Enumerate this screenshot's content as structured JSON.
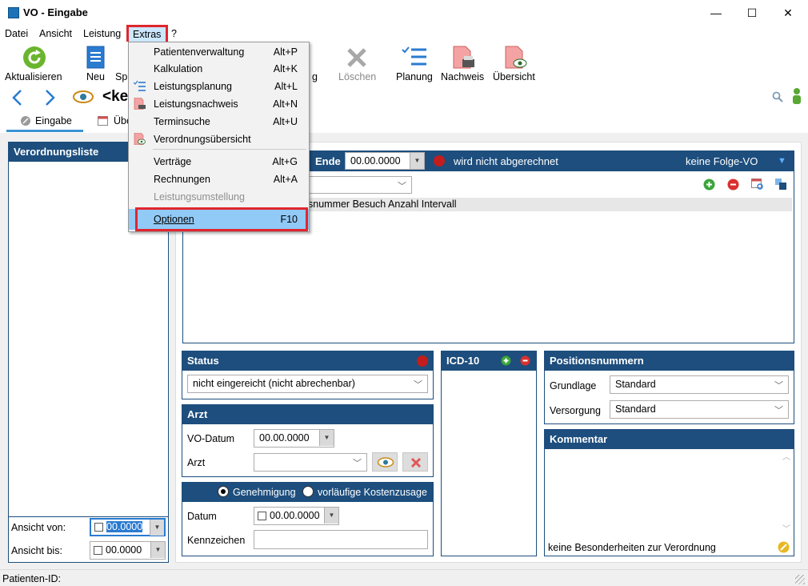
{
  "window": {
    "title": "VO - Eingabe",
    "minimize": "—",
    "maximize": "☐",
    "close": "✕"
  },
  "menu": {
    "datei": "Datei",
    "ansicht": "Ansicht",
    "leistung": "Leistung",
    "extras": "Extras",
    "help": "?"
  },
  "toolbar": {
    "aktualisieren": "Aktualisieren",
    "neu": "Neu",
    "speichern_partial": "Sp",
    "hidden_partial": "g",
    "loeschen": "Löschen",
    "planung": "Planung",
    "nachweis": "Nachweis",
    "uebersicht": "Übersicht"
  },
  "nav": {
    "record_title_partial": "<ke"
  },
  "tabs": {
    "eingabe": "Eingabe",
    "uebersicht_partial": "Übe"
  },
  "dropdown": [
    {
      "label": "Patientenverwaltung",
      "shortcut": "Alt+P",
      "disabled": false
    },
    {
      "label": "Kalkulation",
      "shortcut": "Alt+K",
      "disabled": false
    },
    {
      "label": "Leistungsplanung",
      "shortcut": "Alt+L",
      "disabled": false
    },
    {
      "label": "Leistungsnachweis",
      "shortcut": "Alt+N",
      "disabled": false
    },
    {
      "label": "Terminsuche",
      "shortcut": "Alt+U",
      "disabled": false
    },
    {
      "label": "Verordnungsübersicht",
      "shortcut": "",
      "disabled": false
    },
    {
      "label": "Verträge",
      "shortcut": "Alt+G",
      "disabled": false
    },
    {
      "label": "Rechnungen",
      "shortcut": "Alt+A",
      "disabled": false
    },
    {
      "label": "Leistungsumstellung",
      "shortcut": "",
      "disabled": true
    },
    {
      "label": "Optionen",
      "shortcut": "F10",
      "disabled": false
    }
  ],
  "left_panel": {
    "title": "Verordnungsliste",
    "ansicht_von_label": "Ansicht von:",
    "ansicht_von_value": "00.0000",
    "ansicht_bis_label": "Ansicht bis:",
    "ansicht_bis_value": "00.0000"
  },
  "vo_header": {
    "ende_label": "Ende",
    "ende_value": "00.00.0000",
    "abrechnung_status": "wird nicht abgerechnet",
    "folge_vo": "keine Folge-VO",
    "positions_columns_partial": "snummer Besuch Anzahl Intervall"
  },
  "status": {
    "title": "Status",
    "value": "nicht eingereicht (nicht abrechenbar)"
  },
  "arzt": {
    "title": "Arzt",
    "vo_datum_label": "VO-Datum",
    "vo_datum_value": "00.00.0000",
    "arzt_label": "Arzt",
    "arzt_value": ""
  },
  "genehmigung": {
    "option_genehmigung": "Genehmigung",
    "option_kostenzusage": "vorläufige Kostenzusage",
    "datum_label": "Datum",
    "datum_value": "00.00.0000",
    "kennzeichen_label": "Kennzeichen",
    "kennzeichen_value": ""
  },
  "icd": {
    "title": "ICD-10"
  },
  "positionsnummern": {
    "title": "Positionsnummern",
    "grundlage_label": "Grundlage",
    "grundlage_value": "Standard",
    "versorgung_label": "Versorgung",
    "versorgung_value": "Standard"
  },
  "kommentar": {
    "title": "Kommentar",
    "footer": "keine Besonderheiten zur Verordnung"
  },
  "statusbar": {
    "patienten_id_label": "Patienten-ID:"
  },
  "colors": {
    "header_blue": "#1d4e7d",
    "highlight_red": "#e0262e",
    "status_dot": "#c21d1d",
    "add_green": "#3aa53a"
  }
}
